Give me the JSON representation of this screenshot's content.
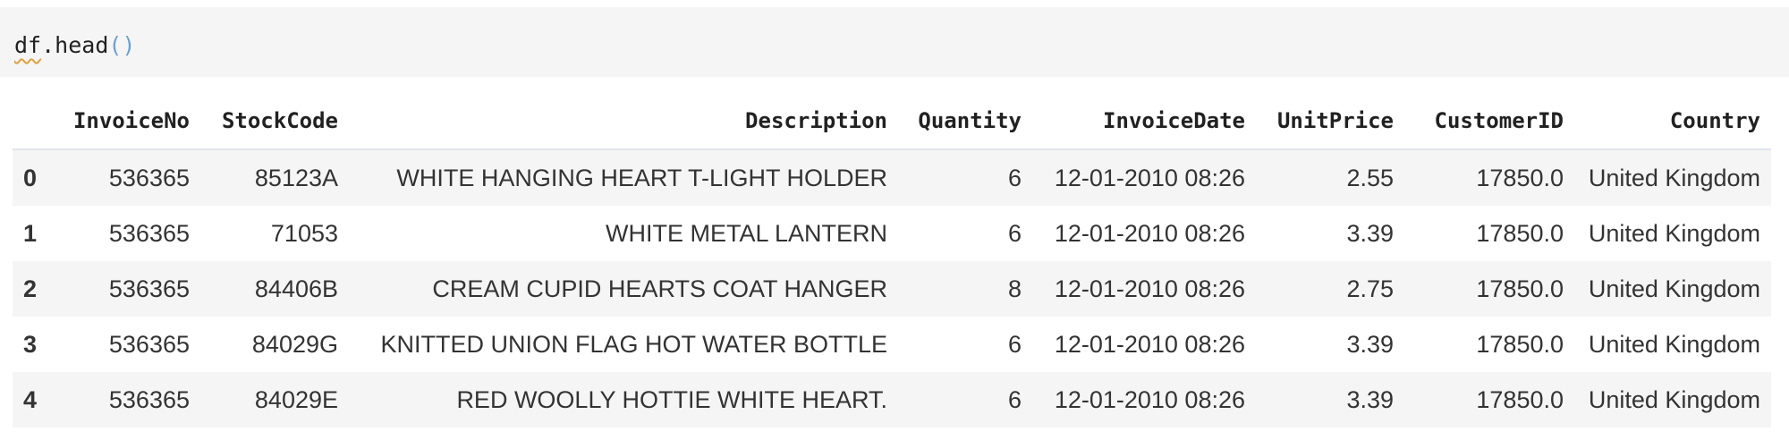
{
  "code_cell": {
    "ident": "df",
    "method": ".head",
    "parens": "()"
  },
  "table": {
    "columns": [
      "",
      "InvoiceNo",
      "StockCode",
      "Description",
      "Quantity",
      "InvoiceDate",
      "UnitPrice",
      "CustomerID",
      "Country"
    ],
    "rows": [
      [
        "0",
        "536365",
        "85123A",
        "WHITE HANGING HEART T-LIGHT HOLDER",
        "6",
        "12-01-2010 08:26",
        "2.55",
        "17850.0",
        "United Kingdom"
      ],
      [
        "1",
        "536365",
        "71053",
        "WHITE METAL LANTERN",
        "6",
        "12-01-2010 08:26",
        "3.39",
        "17850.0",
        "United Kingdom"
      ],
      [
        "2",
        "536365",
        "84406B",
        "CREAM CUPID HEARTS COAT HANGER",
        "8",
        "12-01-2010 08:26",
        "2.75",
        "17850.0",
        "United Kingdom"
      ],
      [
        "3",
        "536365",
        "84029G",
        "KNITTED UNION FLAG HOT WATER BOTTLE",
        "6",
        "12-01-2010 08:26",
        "3.39",
        "17850.0",
        "United Kingdom"
      ],
      [
        "4",
        "536365",
        "84029E",
        "RED WOOLLY HOTTIE WHITE HEART.",
        "6",
        "12-01-2010 08:26",
        "3.39",
        "17850.0",
        "United Kingdom"
      ]
    ]
  },
  "colors": {
    "code_bg": "#f5f5f5",
    "stripe": "#f5f5f5",
    "paren": "#6f9fd0",
    "squiggle": "#e0a040"
  }
}
